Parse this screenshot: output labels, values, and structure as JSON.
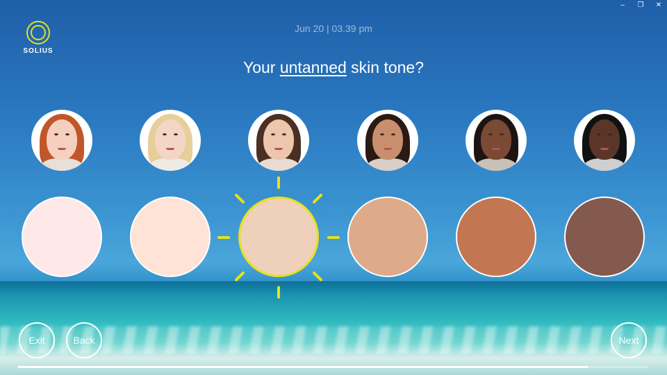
{
  "window": {
    "minimize_icon": "minimize-icon",
    "restore_icon": "restore-icon",
    "close_icon": "close-icon",
    "minimize_glyph": "–",
    "restore_glyph": "❐",
    "close_glyph": "✕"
  },
  "brand": {
    "name": "SOLIUS",
    "accent": "#e6e21a"
  },
  "datetime": "Jun 20 | 03.39 pm",
  "question": {
    "before": "Your ",
    "emphasis": "untanned",
    "after": " skin tone?"
  },
  "options": [
    {
      "swatch": "#ffe8e8",
      "skin": "#f6d0bf",
      "hair": "#c0562a",
      "top": "#e7dfd8",
      "selected": false
    },
    {
      "swatch": "#ffe3d6",
      "skin": "#f3d6c6",
      "hair": "#e6cf98",
      "top": "#f0eae4",
      "selected": false
    },
    {
      "swatch": "#efd0bb",
      "skin": "#ecc6ad",
      "hair": "#4a2f22",
      "top": "#e8dcd2",
      "selected": true
    },
    {
      "swatch": "#ddaa8a",
      "skin": "#c98e6e",
      "hair": "#2b1a14",
      "top": "#d9cfc8",
      "selected": false
    },
    {
      "swatch": "#c27752",
      "skin": "#7a4a35",
      "hair": "#1d1412",
      "top": "#c9c0b8",
      "selected": false
    },
    {
      "swatch": "#855a4e",
      "skin": "#5a3629",
      "hair": "#111",
      "top": "#cfcfcf",
      "selected": false
    }
  ],
  "nav": {
    "exit": "Exit",
    "back": "Back",
    "next": "Next"
  },
  "progress": {
    "fraction": 0.905
  }
}
